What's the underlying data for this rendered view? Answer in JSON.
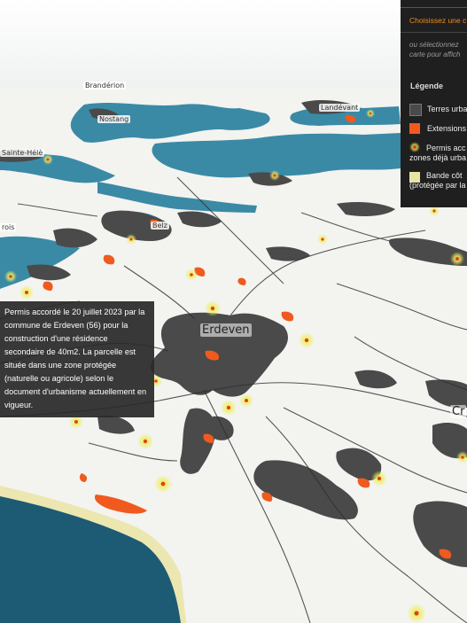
{
  "panel": {
    "choose_label": "Choisissez une c",
    "hint_line1": "ou sélectionnez",
    "hint_line2": "carte pour affich",
    "legend_title": "Légende",
    "legend": [
      {
        "label": "Terres urba",
        "color": "#4a4a4a",
        "icon": "square-swatch"
      },
      {
        "label": "Extensions",
        "color": "#f05a1e",
        "icon": "square-swatch"
      },
      {
        "label_line1": "Permis acc",
        "label_line2": "zones déjà urba",
        "color": "#e4e854",
        "icon": "glow-dot"
      },
      {
        "label_line1": "Bande côt",
        "label_line2": "(protégée par la",
        "color": "#e8e4a8",
        "icon": "square-swatch"
      }
    ]
  },
  "places": {
    "branderion": "Brandérion",
    "nostang": "Nostang",
    "landevant": "Landévant",
    "sainte_helene": "Sainte-Hélè",
    "plouhinec": "rois",
    "belz": "Belz",
    "erdeven": "Erdeven",
    "crach": "Cr"
  },
  "tooltip": {
    "text": "Permis accordé le 20 juillet 2023 par la commune de Erdeven (56) pour la construction d'une résidence secondaire de 40m2. La parcelle est située dans une zone protégée (naturelle ou agricole) selon le document d'urbanisme actuellement en vigueur."
  },
  "colors": {
    "sea": "#1d5a73",
    "estuary": "#3a8aa6",
    "land": "#f2f2ef",
    "urban": "#4a4a4a",
    "extension": "#f05a1e",
    "coastal_band": "#ece6b0",
    "permit_dot": "#e4e854"
  }
}
